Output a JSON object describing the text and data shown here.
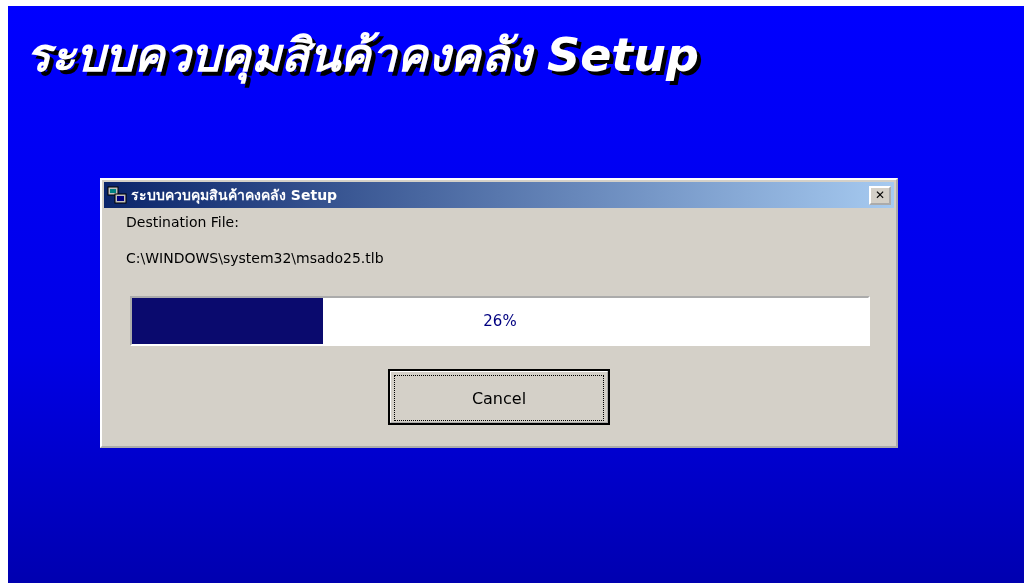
{
  "heading": "ระบบควบคุมสินค้าคงคลัง Setup",
  "dialog": {
    "title": "ระบบควบคุมสินค้าคงคลัง Setup",
    "close": "✕",
    "label": "Destination File:",
    "path": "C:\\WINDOWS\\system32\\msado25.tlb",
    "progress": {
      "level": 0.26,
      "reading": "26%"
    },
    "buttons": [
      {
        "label": "Cancel",
        "focused": true
      }
    ]
  }
}
